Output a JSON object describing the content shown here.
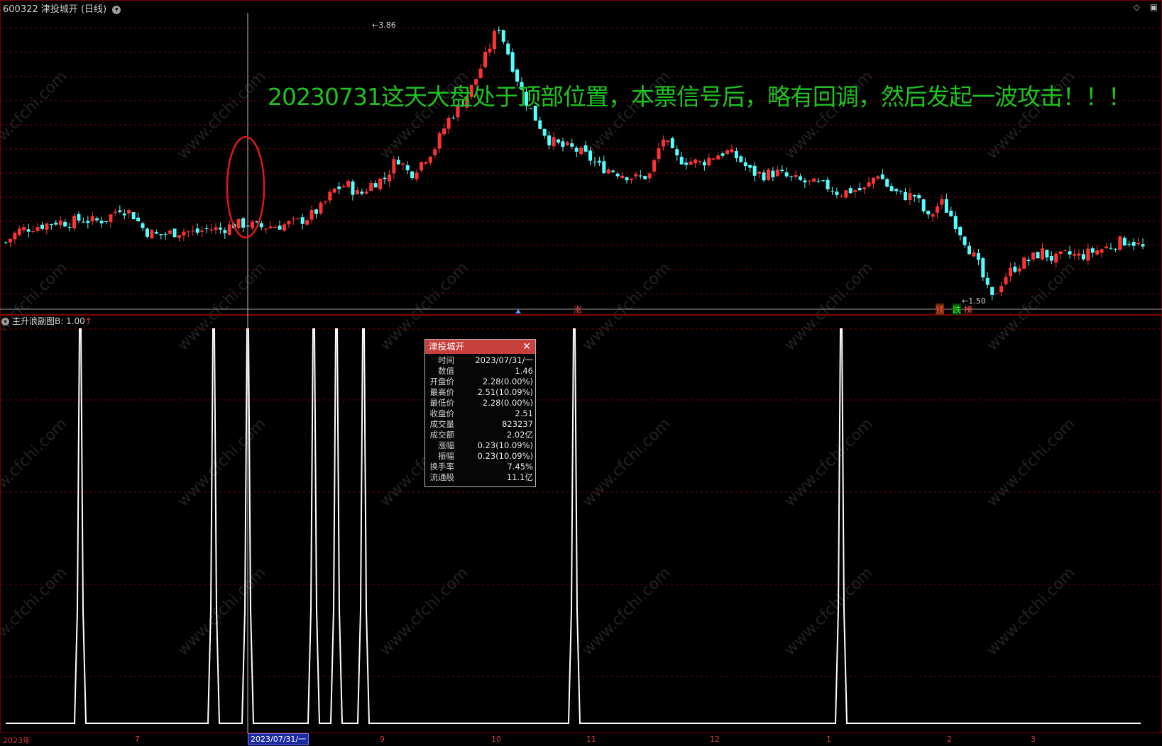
{
  "header": {
    "code": "600322",
    "name": "津投城开",
    "period": "(日线)"
  },
  "window_icons": [
    "diamond-icon",
    "restore-icon"
  ],
  "annotation": "20230731这天大盘处于顶部位置，本票信号后，略有回调，然后发起一波攻击！！！",
  "price_labels": {
    "high": "3.86",
    "low": "1.50"
  },
  "markers": [
    "涨",
    "预",
    "跌",
    "榜"
  ],
  "sub_chart": {
    "title": "主升浪副图B",
    "value": ": 1.00",
    "arrow": "↑"
  },
  "info_box": {
    "title": "津投城开",
    "rows": [
      {
        "label": "时间",
        "value": "2023/07/31/一"
      },
      {
        "label": "数值",
        "value": "1.46"
      },
      {
        "label": "开盘价",
        "value": "2.28(0.00%)"
      },
      {
        "label": "最高价",
        "value": "2.51(10.09%)"
      },
      {
        "label": "最低价",
        "value": "2.28(0.00%)"
      },
      {
        "label": "收盘价",
        "value": "2.51"
      },
      {
        "label": "成交量",
        "value": "823237"
      },
      {
        "label": "成交额",
        "value": "2.02亿"
      },
      {
        "label": "涨幅",
        "value": "0.23(10.09%)"
      },
      {
        "label": "振幅",
        "value": "0.23(10.09%)"
      },
      {
        "label": "换手率",
        "value": "7.45%"
      },
      {
        "label": "流通股",
        "value": "11.1亿"
      }
    ]
  },
  "time_axis": {
    "labels": [
      "2023年",
      "7",
      "9",
      "10",
      "11",
      "12",
      "1",
      "2",
      "3"
    ],
    "highlight": "2023/07/31/一"
  },
  "watermark": "www.cfchi.com",
  "colors": {
    "up": "#ff3232",
    "down": "#54ffff",
    "grid": "#7a0000",
    "annotation": "#1fc21f",
    "signal": "#ffffff"
  },
  "chart_data": {
    "type": "candlestick",
    "title": "600322 津投城开 (日线)",
    "price_range": [
      1.5,
      3.86
    ],
    "close_path": [
      2.0,
      2.1,
      2.13,
      2.15,
      2.18,
      2.17,
      2.2,
      2.18,
      2.2,
      2.3,
      2.25,
      2.1,
      2.06,
      2.08,
      2.1,
      2.08,
      2.12,
      2.11,
      2.15,
      2.16,
      2.13,
      2.14,
      2.15,
      2.17,
      2.22,
      2.3,
      2.45,
      2.5,
      2.4,
      2.51,
      2.55,
      2.73,
      2.58,
      2.7,
      2.82,
      3.05,
      3.18,
      3.35,
      3.6,
      3.86,
      3.55,
      3.25,
      3.05,
      2.88,
      2.82,
      2.8,
      2.74,
      2.65,
      2.62,
      2.58,
      2.55,
      2.58,
      2.9,
      2.72,
      2.7,
      2.68,
      2.74,
      2.78,
      2.72,
      2.6,
      2.58,
      2.6,
      2.55,
      2.52,
      2.5,
      2.48,
      2.42,
      2.45,
      2.45,
      2.6,
      2.45,
      2.4,
      2.4,
      2.2,
      2.35,
      2.2,
      2.0,
      1.8,
      1.5,
      1.7,
      1.8,
      1.85,
      1.92,
      1.85,
      1.9,
      1.88,
      1.92,
      1.95,
      2.0,
      2.02,
      1.95
    ],
    "signal": {
      "type": "line",
      "values": [
        0,
        1
      ],
      "pulses_at_index": [
        8,
        26,
        30,
        38,
        41,
        44,
        63,
        93
      ]
    }
  }
}
